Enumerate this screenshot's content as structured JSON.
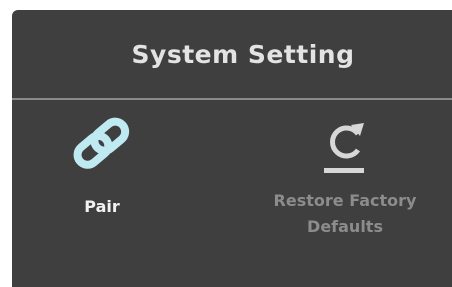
{
  "header": {
    "title": "System Setting"
  },
  "options": [
    {
      "label": "Pair",
      "icon": "link-chain-icon",
      "state": "selected",
      "color": "#bfeaf2"
    },
    {
      "label_line1": "Restore Factory",
      "label_line2": "Defaults",
      "icon": "restore-refresh-icon",
      "state": "unselected",
      "color": "#d7d7d7"
    }
  ]
}
